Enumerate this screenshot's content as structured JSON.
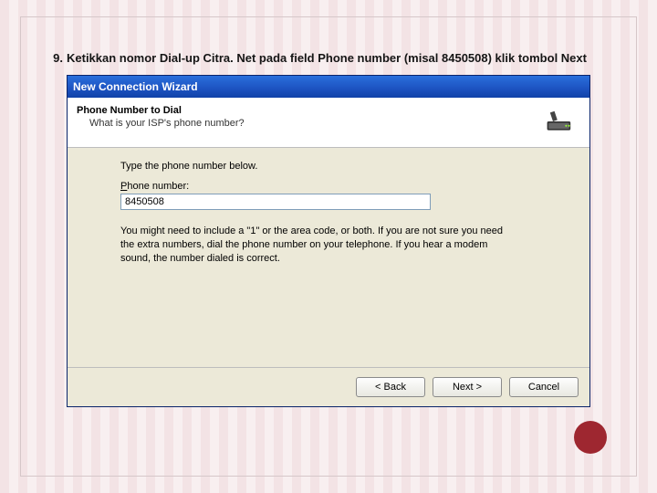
{
  "step": {
    "number": "9.",
    "text_before": "Ketikkan nomor Dial-up Citra. Net pada field Phone number (misal 8450508) klik tombol ",
    "text_bold_tail": "Next"
  },
  "window": {
    "title": "New Connection Wizard",
    "header_title": "Phone Number to Dial",
    "header_sub": "What is your ISP's phone number?",
    "prompt": "Type the phone number below.",
    "field_label_prefix": "P",
    "field_label_rest": "hone number:",
    "phone_value": "8450508",
    "hint": "You might need to include a \"1\" or the area code, or both. If you are not sure you need the extra numbers, dial the phone number on your telephone. If you hear a modem sound, the number dialed is correct.",
    "buttons": {
      "back": "< Back",
      "next": "Next >",
      "cancel": "Cancel"
    }
  }
}
